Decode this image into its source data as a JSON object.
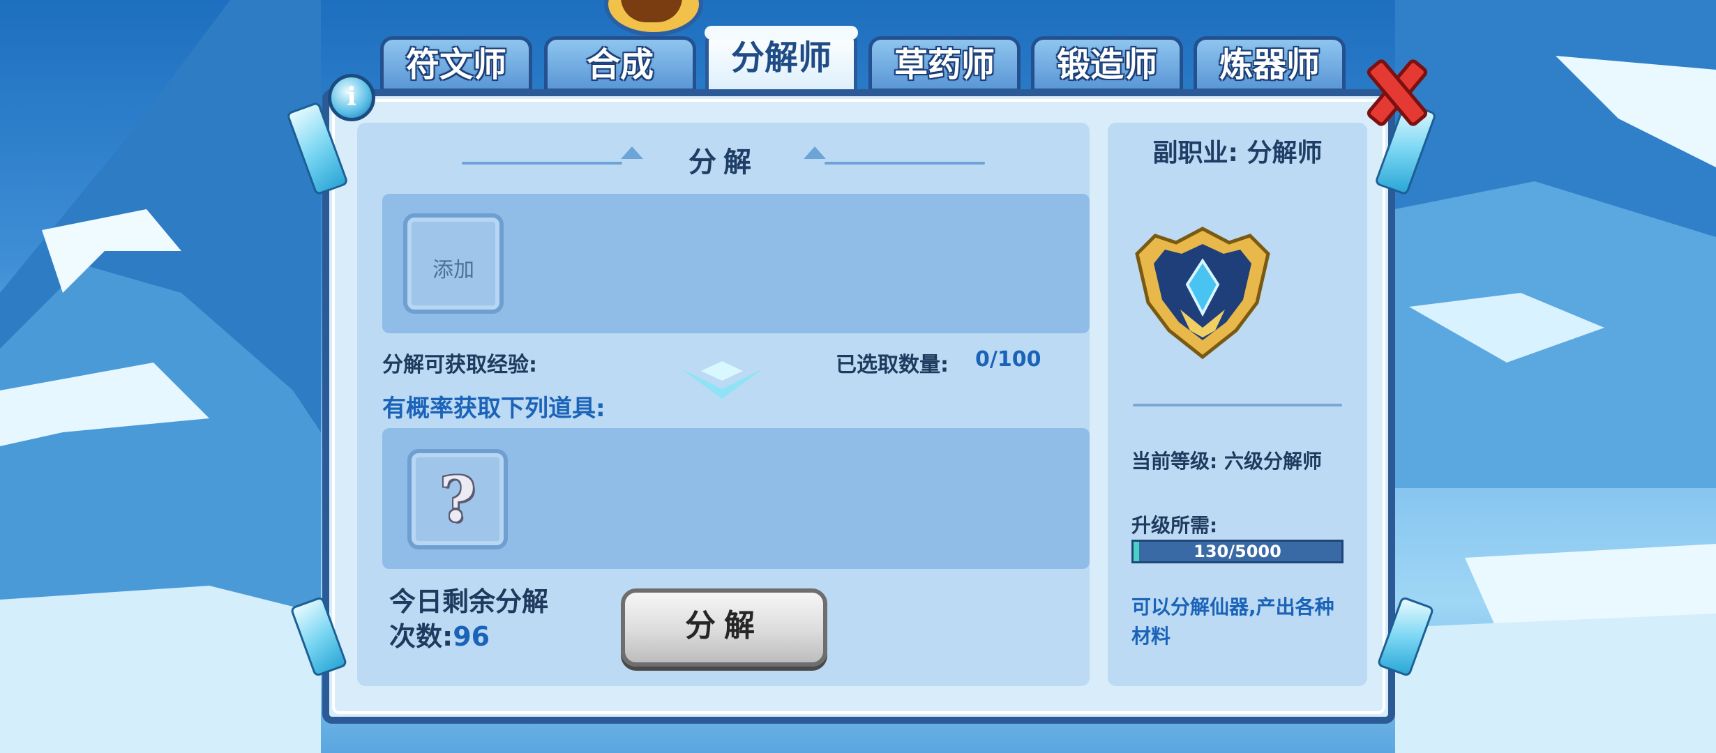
{
  "tabs": [
    {
      "label": "符文师",
      "active": false
    },
    {
      "label": "合成",
      "active": false
    },
    {
      "label": "分解师",
      "active": true
    },
    {
      "label": "草药师",
      "active": false
    },
    {
      "label": "锻造师",
      "active": false
    },
    {
      "label": "炼器师",
      "active": false
    }
  ],
  "info_icon": "i",
  "main": {
    "section_title": "分解",
    "add_slot_label": "添加",
    "exp_label": "分解可获取经验:",
    "selected_count_label": "已选取数量:",
    "selected_count_value": "0/100",
    "probability_label": "有概率获取下列道具:",
    "reward_placeholder": "?",
    "remaining_label_line1": "今日剩余分解",
    "remaining_label_line2": "次数:",
    "remaining_value": "96",
    "decompose_button": "分解"
  },
  "profession": {
    "title": "副职业: 分解师",
    "current_level": "当前等级: 六级分解师",
    "upgrade_label": "升级所需:",
    "progress_text": "130/5000",
    "progress_fraction": 0.026,
    "description": "可以分解仙器,产出各种材料"
  },
  "colors": {
    "accent_blue": "#1b63b8",
    "frame_border": "#2c5a97",
    "close_red": "#e53a33",
    "progress_fill": "#48d2c5"
  },
  "icons": [
    "info-icon",
    "close-icon",
    "question-mark-icon",
    "emblem-icon",
    "chevron-down-icon"
  ]
}
